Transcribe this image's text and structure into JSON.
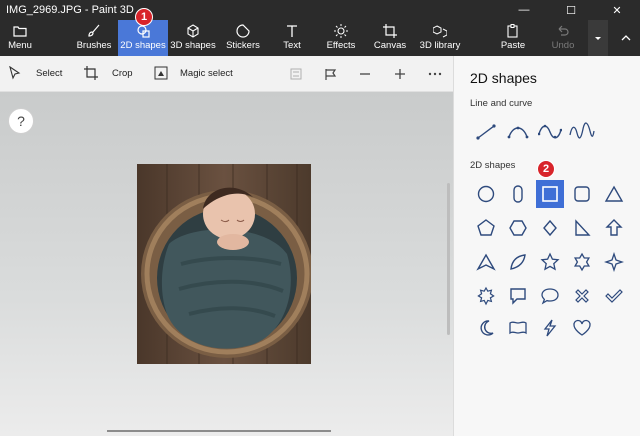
{
  "window": {
    "title": "IMG_2969.JPG - Paint 3D",
    "minimize": "—",
    "maximize": "☐",
    "close": "✕"
  },
  "ribbon": {
    "menu": "Menu",
    "brushes": "Brushes",
    "shapes2d": "2D shapes",
    "shapes3d": "3D shapes",
    "stickers": "Stickers",
    "text": "Text",
    "effects": "Effects",
    "canvas": "Canvas",
    "library3d": "3D library",
    "paste": "Paste",
    "undo": "Undo",
    "active_tab": "2D shapes"
  },
  "markers": {
    "one": "1",
    "two": "2"
  },
  "toolbar": {
    "select": "Select",
    "crop": "Crop",
    "magic_select": "Magic select"
  },
  "canvas": {
    "help": "?"
  },
  "panel": {
    "title": "2D shapes",
    "line_section": "Line and curve",
    "shapes_section": "2D shapes",
    "selected_shape": "rectangle"
  },
  "colors": {
    "ribbon_bg": "#2b2b2b",
    "accent": "#4a78d8",
    "shape_selected": "#3f6fd6",
    "shape_stroke": "#2e4a7d",
    "marker": "#d8242a"
  }
}
